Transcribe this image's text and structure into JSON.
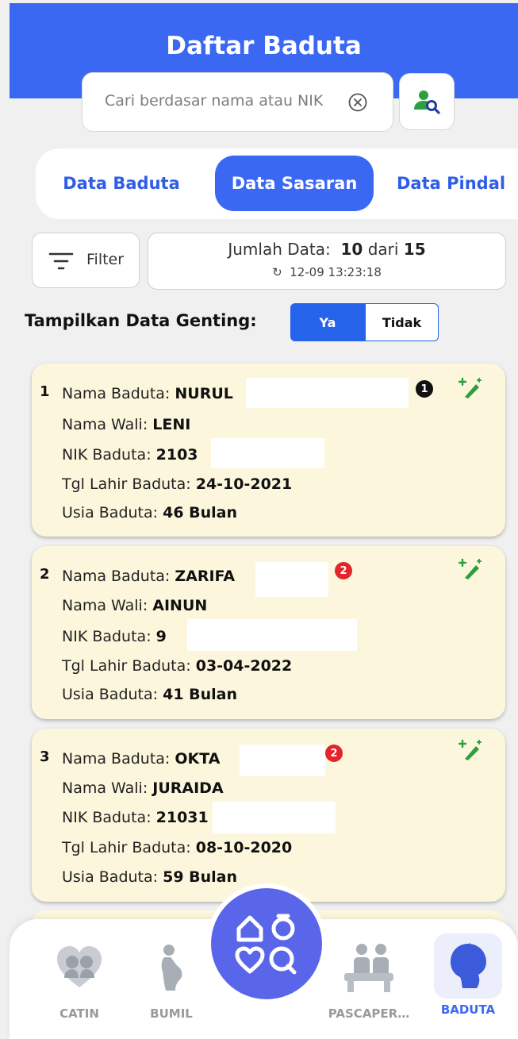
{
  "header": {
    "title": "Daftar Baduta"
  },
  "search": {
    "placeholder": "Cari berdasar nama atau NIK"
  },
  "tabs": [
    {
      "label": "Data Baduta",
      "active": false
    },
    {
      "label": "Data Sasaran",
      "active": true
    },
    {
      "label": "Data Pindal",
      "active": false
    }
  ],
  "filter": {
    "label": "Filter"
  },
  "count": {
    "prefix": "Jumlah Data:",
    "shown": "10",
    "of_label": "dari",
    "total": "15",
    "sync_time": "12-09 13:23:18"
  },
  "genting": {
    "label": "Tampilkan Data Genting:",
    "yes": "Ya",
    "no": "Tidak",
    "selected": "Ya"
  },
  "labels": {
    "nama_baduta": "Nama Baduta:",
    "nama_wali": "Nama Wali:",
    "nik_baduta": "NIK Baduta:",
    "tgl_lahir": "Tgl Lahir Baduta:",
    "usia": "Usia Baduta:"
  },
  "cards": [
    {
      "num": "1",
      "nama": "NURUL",
      "wali": "LENI",
      "nik": "2103",
      "tgl_lahir": "24-10-2021",
      "usia": "46 Bulan",
      "badge": "1",
      "badge_color": "#111111"
    },
    {
      "num": "2",
      "nama": "ZARIFA",
      "wali": "AINUN",
      "nik": "9",
      "tgl_lahir": "03-04-2022",
      "usia": "41 Bulan",
      "badge": "2",
      "badge_color": "#e3242b"
    },
    {
      "num": "3",
      "nama": "OKTA",
      "wali": "JURAIDA",
      "nik": "21031",
      "tgl_lahir": "08-10-2020",
      "usia": "59 Bulan",
      "badge": "2",
      "badge_color": "#e3242b"
    }
  ],
  "nav": [
    {
      "label": "CATIN",
      "active": false
    },
    {
      "label": "BUMIL",
      "active": false
    },
    {
      "label": "PASCAPER…",
      "active": false
    },
    {
      "label": "BADUTA",
      "active": true
    }
  ],
  "colors": {
    "primary": "#3b68f2",
    "card_bg": "#fcf7dc",
    "edit_green": "#2e9e3f",
    "fab": "#5a66ea"
  }
}
